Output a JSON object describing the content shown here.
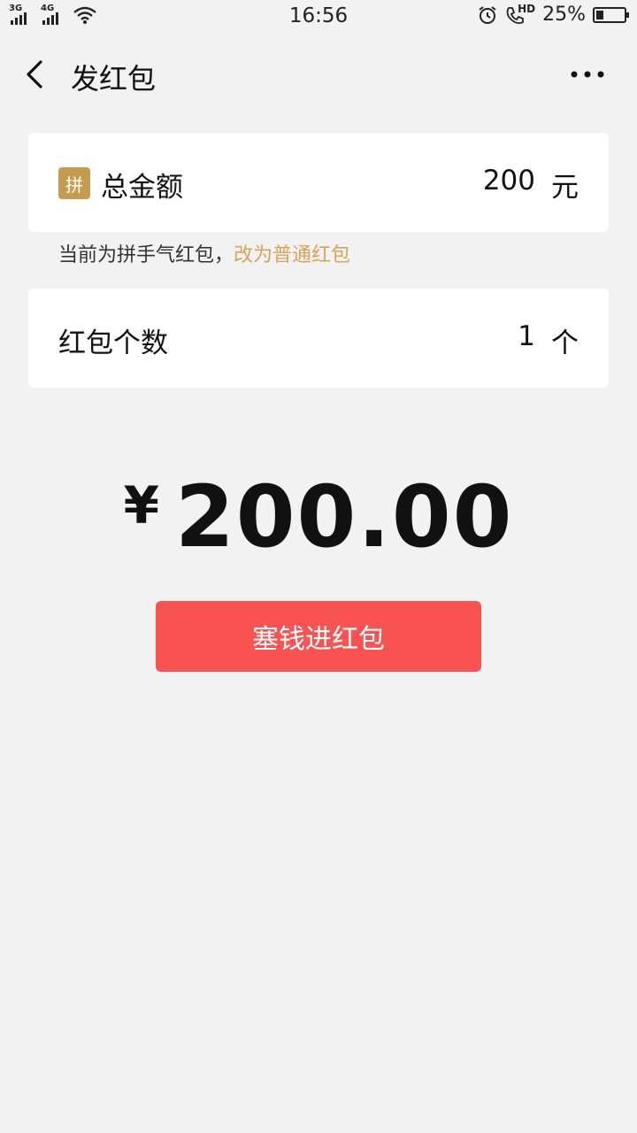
{
  "status_bar": {
    "sim1": "3G",
    "sim2": "4G",
    "time": "16:56",
    "hd": "HD",
    "battery_text": "25%",
    "battery_level": 0.25,
    "icons": [
      "signal-icon",
      "wifi-icon",
      "alarm-icon",
      "hd-call-icon",
      "battery-icon"
    ]
  },
  "header": {
    "title": "发红包",
    "back_icon": "chevron-left-icon",
    "more_icon": "more-dots-icon"
  },
  "amount_card": {
    "badge": "拼",
    "label": "总金额",
    "value": "200",
    "unit": "元"
  },
  "tip": {
    "text": "当前为拼手气红包，",
    "link": "改为普通红包"
  },
  "count_card": {
    "label": "红包个数",
    "value": "1",
    "unit": "个"
  },
  "total": {
    "currency": "¥",
    "amount": "200.00"
  },
  "submit_button": {
    "label": "塞钱进红包"
  },
  "colors": {
    "background": "#f2f2f2",
    "button": "#f85352",
    "badge": "#c59b4f",
    "link": "#d4a45a"
  }
}
